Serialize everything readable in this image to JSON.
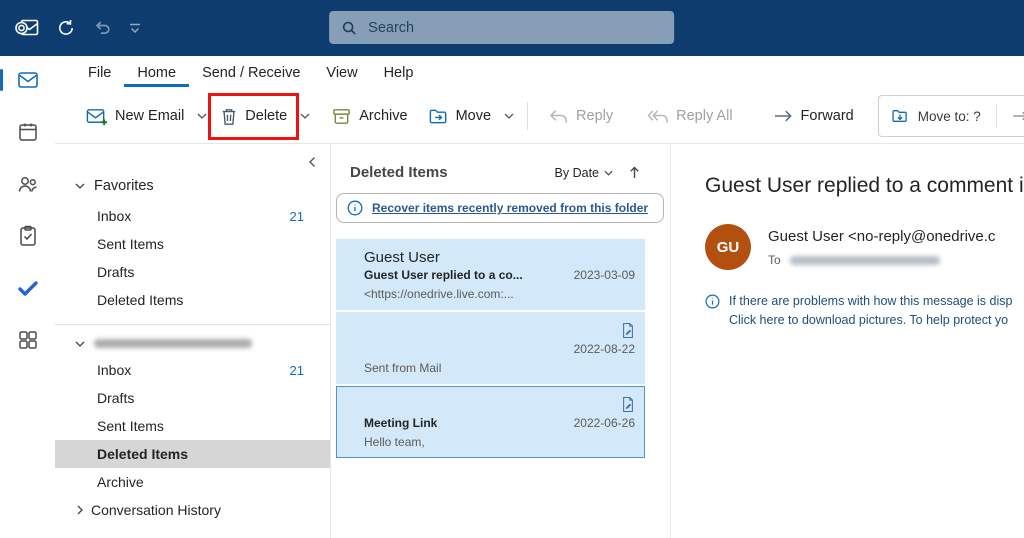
{
  "titlebar": {
    "search_placeholder": "Search"
  },
  "menubar": {
    "tabs": [
      {
        "label": "File"
      },
      {
        "label": "Home",
        "active": true
      },
      {
        "label": "Send / Receive"
      },
      {
        "label": "View"
      },
      {
        "label": "Help"
      }
    ]
  },
  "ribbon": {
    "new_email_label": "New Email",
    "delete_label": "Delete",
    "archive_label": "Archive",
    "move_label": "Move",
    "reply_label": "Reply",
    "reply_all_label": "Reply All",
    "forward_label": "Forward",
    "move_to_label": "Move to: ?",
    "to_label": "To"
  },
  "rail": {
    "items": [
      "mail",
      "calendar",
      "people",
      "tasks",
      "todo",
      "apps"
    ],
    "active": "mail"
  },
  "folder_pane": {
    "favorites_header": "Favorites",
    "favorites": [
      {
        "name": "Inbox",
        "count": "21"
      },
      {
        "name": "Sent Items"
      },
      {
        "name": "Drafts"
      },
      {
        "name": "Deleted Items"
      }
    ],
    "account_email_blurred": true,
    "account_folders": [
      {
        "name": "Inbox",
        "count": "21"
      },
      {
        "name": "Drafts"
      },
      {
        "name": "Sent Items"
      },
      {
        "name": "Deleted Items",
        "selected": true
      },
      {
        "name": "Archive"
      },
      {
        "name": "Conversation History",
        "expandable": true
      }
    ]
  },
  "message_list": {
    "header": "Deleted Items",
    "sort_by": "By Date",
    "sort_direction": "ascending",
    "recover_banner": "Recover items recently removed from this folder",
    "items": [
      {
        "sender": "Guest User",
        "subject": "Guest User replied to a co...",
        "date": "2023-03-09",
        "preview": "<https://onedrive.live.com:..."
      },
      {
        "date": "2022-08-22",
        "preview": "Sent from Mail",
        "has_document_icon": true
      },
      {
        "subject": "Meeting Link",
        "date": "2022-06-26",
        "preview": "Hello team,",
        "has_document_icon": true,
        "selected": true
      }
    ]
  },
  "reading_pane": {
    "subject": "Guest User replied to a comment i",
    "avatar_initials": "GU",
    "sender": "Guest User <no-reply@onedrive.c",
    "to_label": "To",
    "recipient_blurred": true,
    "info_text_1": "If there are problems with how this message is disp",
    "info_text_2": "Click here to download pictures. To help protect yo"
  },
  "colors": {
    "titlebar_bg": "#0e3c6e",
    "accent_blue": "#0f6cbd",
    "annotation_red": "#ee1111",
    "list_item_selection_bg": "#d3e8f8",
    "selected_item_border": "#4e95d0",
    "avatar_orange": "#b4500f",
    "unread_count_blue": "#0f6cbd",
    "folder_selected_bg": "#d6d6d6",
    "info_text_navy": "#1f4e79"
  },
  "icons": [
    "outlook-app-icon",
    "send-receive-icon",
    "undo-icon",
    "customize-toolbar-icon",
    "search-icon",
    "mail-icon",
    "calendar-icon",
    "people-icon",
    "tasks-icon",
    "todo-icon",
    "apps-grid-icon",
    "new-email-icon",
    "delete-icon",
    "archive-icon",
    "move-icon",
    "reply-icon",
    "reply-all-icon",
    "forward-icon",
    "move-to-icon",
    "to-arrow-icon",
    "chevron-down-icon",
    "chevron-left-icon",
    "chevron-right-icon",
    "info-icon",
    "sort-ascending-icon",
    "document-edit-icon"
  ]
}
